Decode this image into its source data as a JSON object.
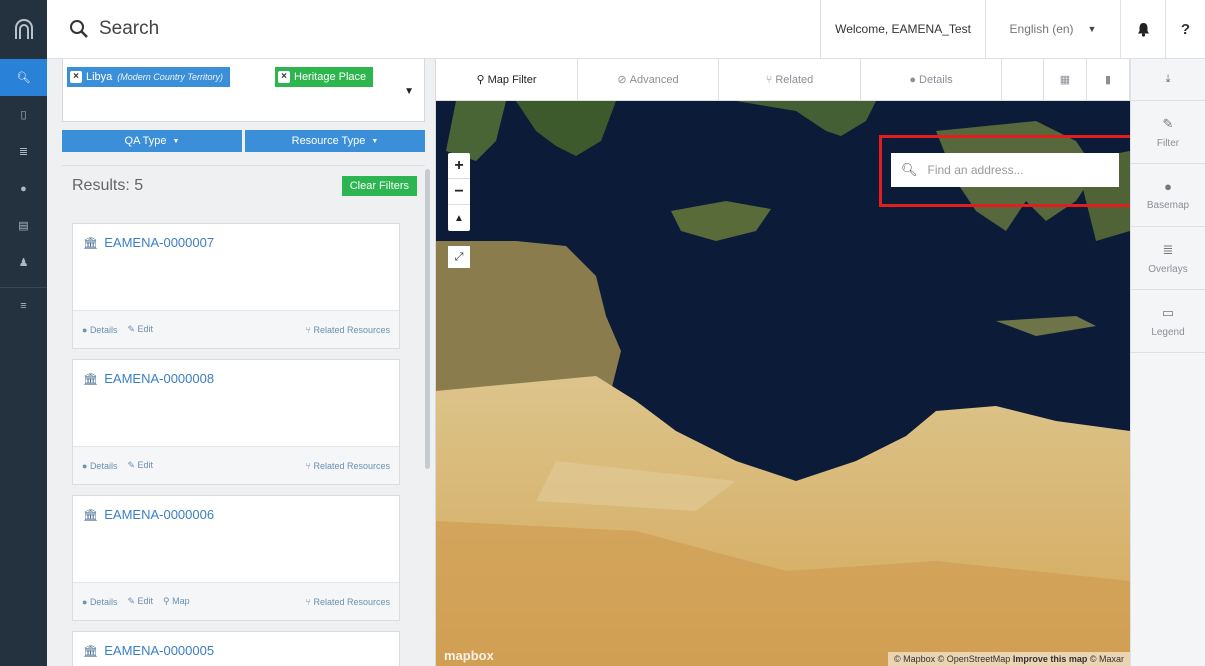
{
  "topbar": {
    "search_label": "Search",
    "welcome": "Welcome, EAMENA_Test",
    "language": "English (en)"
  },
  "filters": {
    "tags": [
      {
        "label": "Libya",
        "sublabel": "(Modern Country Territory)",
        "color": "#3a8fd8"
      },
      {
        "label": "Heritage Place",
        "color": "#2db64e"
      }
    ],
    "dropdowns": [
      "QA Type",
      "Resource Type"
    ]
  },
  "results": {
    "title": "Results: 5",
    "clear_label": "Clear Filters",
    "cards": [
      {
        "title": "EAMENA-0000007",
        "links": [
          "Details",
          "Edit"
        ],
        "related": "Related Resources"
      },
      {
        "title": "EAMENA-0000008",
        "links": [
          "Details",
          "Edit"
        ],
        "related": "Related Resources"
      },
      {
        "title": "EAMENA-0000006",
        "links": [
          "Details",
          "Edit",
          "Map"
        ],
        "related": "Related Resources"
      },
      {
        "title": "EAMENA-0000005"
      }
    ]
  },
  "map": {
    "tabs": [
      "Map Filter",
      "Advanced",
      "Related",
      "Details"
    ],
    "address_placeholder": "Find an address...",
    "logo": "mapbox",
    "attribution": {
      "mapbox": "© Mapbox",
      "osm": "© OpenStreetMap",
      "improve": "Improve this map",
      "maxar": "© Maxar"
    }
  },
  "tools": [
    "Filter",
    "Basemap",
    "Overlays",
    "Legend"
  ],
  "colors": {
    "accent": "#2a82d8",
    "green": "#2cb551",
    "highlight": "#e31d1d",
    "sea": "#0c1c38",
    "desert": "#d9b872"
  }
}
